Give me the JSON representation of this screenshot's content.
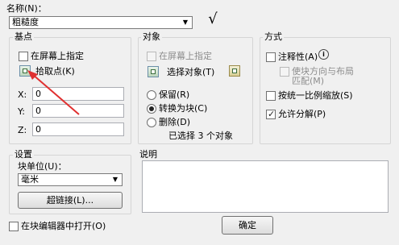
{
  "name_section": {
    "label": "名称(N)：",
    "value": "粗糙度",
    "symbol": "√"
  },
  "base_point": {
    "title": "基点",
    "specify_on_screen": "在屏幕上指定",
    "pick_point": "拾取点(K)",
    "x_label": "X:",
    "x_value": "0",
    "y_label": "Y:",
    "y_value": "0",
    "z_label": "Z:",
    "z_value": "0"
  },
  "objects": {
    "title": "对象",
    "specify_on_screen": "在屏幕上指定",
    "select_objects": "选择对象(T)",
    "retain": "保留(R)",
    "convert_to_block": "转换为块(C)",
    "delete": "删除(D)",
    "selected_count": "已选择 3 个对象",
    "selected_option": "convert_to_block"
  },
  "behavior": {
    "title": "方式",
    "annotative": "注释性(A)",
    "match_orientation_line1": "使块方向与布局",
    "match_orientation_line2": "匹配(M)",
    "scale_uniformly": "按统一比例缩放(S)",
    "allow_exploding": "允许分解(P)",
    "allow_exploding_checked": true
  },
  "settings": {
    "title": "设置",
    "block_unit_label": "块单位(U)：",
    "block_unit_value": "毫米",
    "hyperlink": "超链接(L)..."
  },
  "description": {
    "title": "说明"
  },
  "footer": {
    "open_in_editor": "在块编辑器中打开(O)",
    "ok": "确定"
  },
  "colors": {
    "annotation_arrow": "#e03030",
    "background": "#f0f0f0"
  }
}
